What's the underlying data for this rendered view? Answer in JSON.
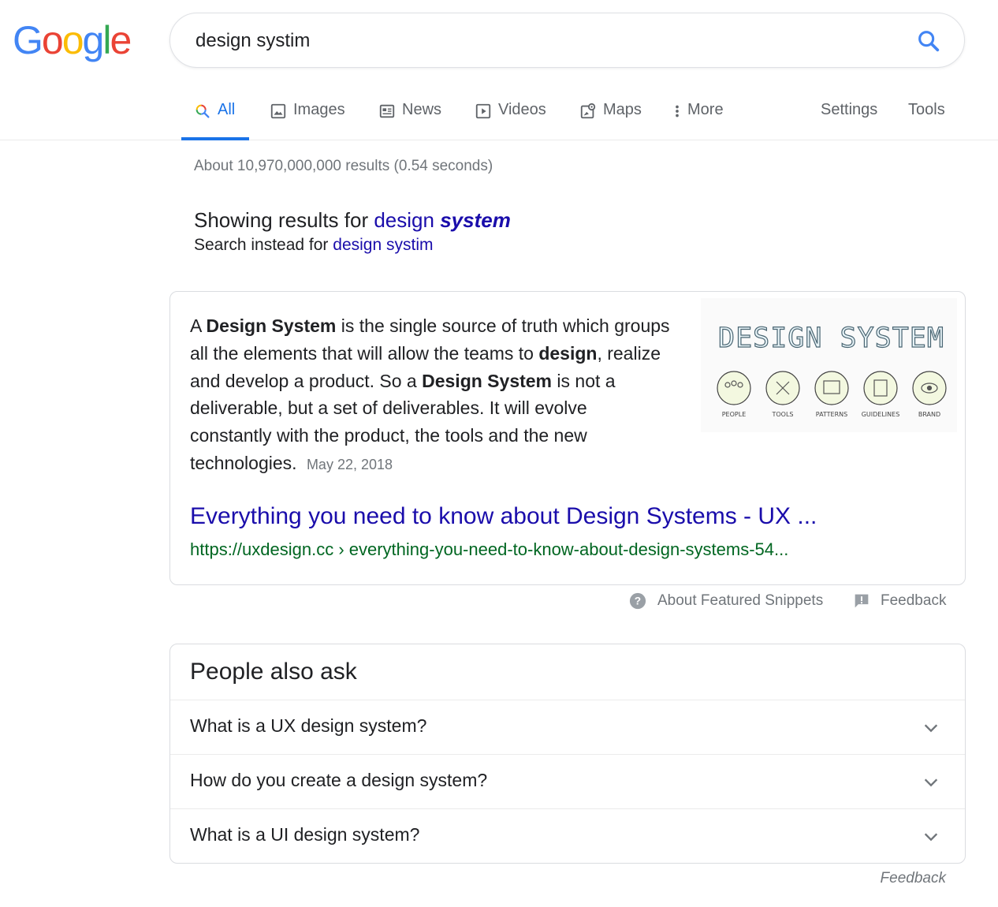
{
  "logo": {
    "letters": [
      "G",
      "o",
      "o",
      "g",
      "l",
      "e"
    ],
    "colors": [
      "#4285F4",
      "#EA4335",
      "#FBBC05",
      "#4285F4",
      "#34A853",
      "#EA4335"
    ]
  },
  "search": {
    "value": "design systim",
    "button_icon": "search-icon"
  },
  "tabs": [
    {
      "label": "All",
      "icon": "search-multicolor-icon",
      "active": true
    },
    {
      "label": "Images",
      "icon": "image-icon"
    },
    {
      "label": "News",
      "icon": "news-icon"
    },
    {
      "label": "Videos",
      "icon": "video-icon"
    },
    {
      "label": "Maps",
      "icon": "map-icon"
    },
    {
      "label": "More",
      "icon": "more-vert-icon"
    }
  ],
  "settings_label": "Settings",
  "tools_label": "Tools",
  "result_stats": "About 10,970,000,000 results (0.54 seconds)",
  "spelling": {
    "showing_prefix": "Showing results for",
    "corrected_plain": "design",
    "corrected_bold": "system",
    "instead_prefix": "Search instead for",
    "original_query": "design systim"
  },
  "snippet": {
    "text_parts": [
      {
        "t": "A "
      },
      {
        "t": "Design System",
        "b": true
      },
      {
        "t": " is the single source of truth which groups all the elements that will allow the teams to "
      },
      {
        "t": "design",
        "b": true
      },
      {
        "t": ", realize and develop a product. So a "
      },
      {
        "t": "Design System",
        "b": true
      },
      {
        "t": " is not a deliverable, but a set of deliverables. It will evolve constantly with the product, the tools and the new technologies."
      }
    ],
    "date": "May 22, 2018",
    "image": {
      "heading": "DESIGN SYSTEM",
      "labels": [
        "PEOPLE",
        "TOOLS",
        "PATTERNS",
        "GUIDELINES",
        "BRAND"
      ]
    },
    "title": "Everything you need to know about Design Systems - UX ...",
    "url": "https://uxdesign.cc › everything-you-need-to-know-about-design-systems-54..."
  },
  "snippet_footer": {
    "about_label": "About Featured Snippets",
    "feedback_label": "Feedback"
  },
  "paa": {
    "title": "People also ask",
    "questions": [
      "What is a UX design system?",
      "How do you create a design system?",
      "What is a UI design system?"
    ]
  },
  "bottom_feedback": "Feedback"
}
